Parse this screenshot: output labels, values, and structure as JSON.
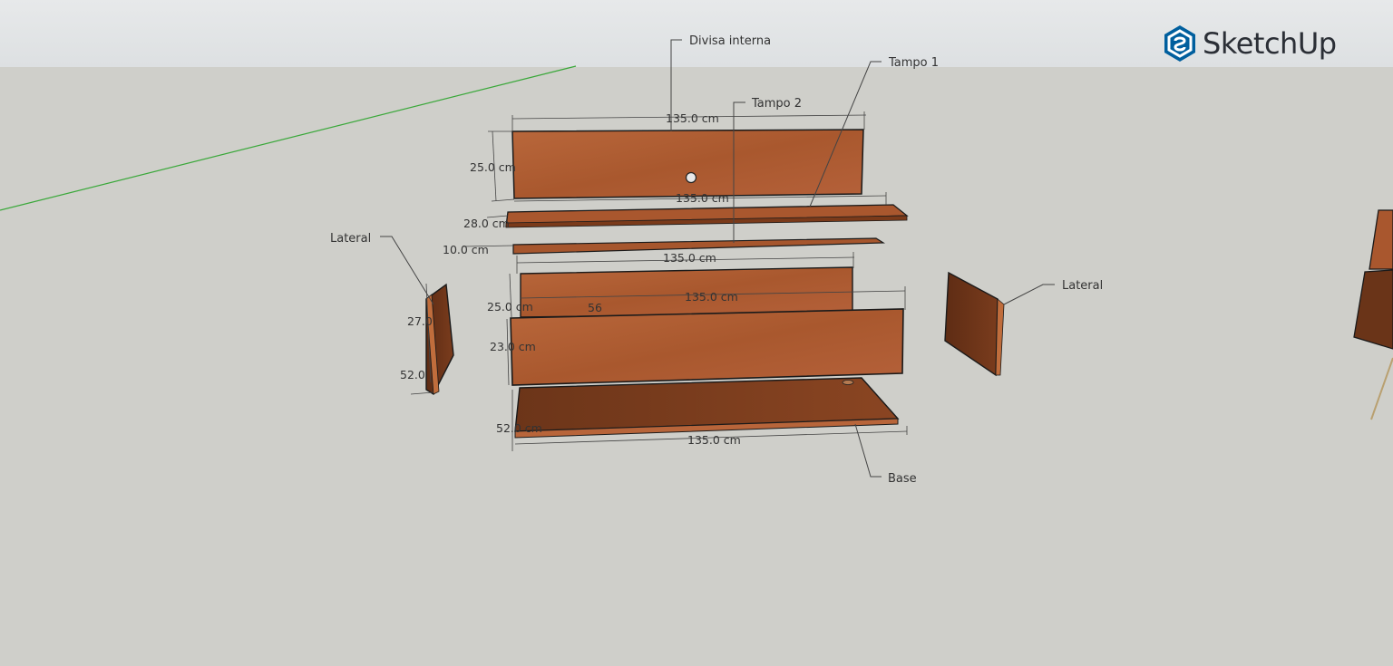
{
  "app": {
    "brand": "SketchUp",
    "accent": "#005f9e"
  },
  "labels": {
    "divisa_interna": "Divisa interna",
    "tampo1": "Tampo 1",
    "tampo2": "Tampo 2",
    "lateral_left": "Lateral",
    "lateral_right": "Lateral",
    "base": "Base"
  },
  "dimensions": {
    "top_width": "135.0 cm",
    "top_height": "25.0 cm",
    "tampo1_width": "135.0 cm",
    "tampo1_depth": "28.0 cm",
    "tampo2_depth": "10.0 cm",
    "tampo2_width": "135.0 cm",
    "back_height": "25.0 cm",
    "front_width": "135.0 cm",
    "front_height": "23.0 cm",
    "side_height": "27.0",
    "side_depth": "52.0",
    "base_depth": "52.0 cm",
    "base_width": "135.0 cm",
    "hidden_fragment": "56"
  },
  "colors": {
    "wood_light": "#b8653a",
    "wood_mid": "#a5552c",
    "wood_dark": "#6a3418",
    "axis_green": "#3aa83a"
  }
}
